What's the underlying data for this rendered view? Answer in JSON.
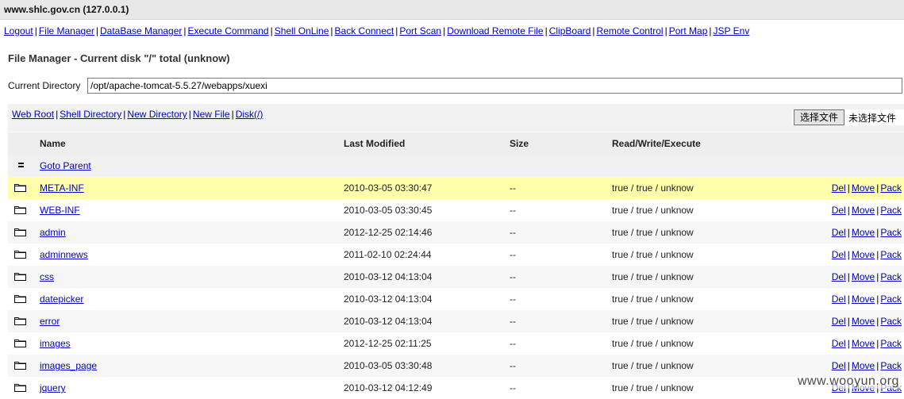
{
  "window": {
    "title": "www.shlc.gov.cn (127.0.0.1)"
  },
  "nav": {
    "items": [
      {
        "label": "Logout",
        "name": "nav-logout"
      },
      {
        "label": "File Manager",
        "name": "nav-file-manager"
      },
      {
        "label": "DataBase Manager",
        "name": "nav-database-manager"
      },
      {
        "label": "Execute Command",
        "name": "nav-execute-command"
      },
      {
        "label": "Shell OnLine",
        "name": "nav-shell-online"
      },
      {
        "label": "Back Connect",
        "name": "nav-back-connect"
      },
      {
        "label": "Port Scan",
        "name": "nav-port-scan"
      },
      {
        "label": "Download Remote File",
        "name": "nav-download-remote-file"
      },
      {
        "label": "ClipBoard",
        "name": "nav-clipboard"
      },
      {
        "label": "Remote Control",
        "name": "nav-remote-control"
      },
      {
        "label": "Port Map",
        "name": "nav-port-map"
      },
      {
        "label": "JSP Env",
        "name": "nav-jsp-env"
      }
    ],
    "separator": "|"
  },
  "page": {
    "title": "File Manager - Current disk \"/\" total (unknow)",
    "current_directory_label": "Current Directory",
    "current_directory_value": "/opt/apache-tomcat-5.5.27/webapps/xuexi"
  },
  "actions": {
    "items": [
      {
        "label": "Web Root",
        "name": "action-web-root"
      },
      {
        "label": "Shell Directory",
        "name": "action-shell-directory"
      },
      {
        "label": "New Directory",
        "name": "action-new-directory"
      },
      {
        "label": "New File",
        "name": "action-new-file"
      },
      {
        "label": "Disk(/)",
        "name": "action-disk"
      }
    ],
    "upload_button": "选择文件",
    "upload_status": "未选择文件"
  },
  "table": {
    "headers": {
      "name": "Name",
      "modified": "Last Modified",
      "size": "Size",
      "rwx": "Read/Write/Execute"
    },
    "parent_label": "Goto Parent",
    "ops": {
      "del": "Del",
      "move": "Move",
      "pack": "Pack"
    },
    "rows": [
      {
        "name": "META-INF",
        "modified": "2010-03-05 03:30:47",
        "size": "--",
        "rwx": "true / true / unknow",
        "highlight": true
      },
      {
        "name": "WEB-INF",
        "modified": "2010-03-05 03:30:45",
        "size": "--",
        "rwx": "true / true / unknow"
      },
      {
        "name": "admin",
        "modified": "2012-12-25 02:14:46",
        "size": "--",
        "rwx": "true / true / unknow"
      },
      {
        "name": "adminnews",
        "modified": "2011-02-10 02:24:44",
        "size": "--",
        "rwx": "true / true / unknow"
      },
      {
        "name": "css",
        "modified": "2010-03-12 04:13:04",
        "size": "--",
        "rwx": "true / true / unknow"
      },
      {
        "name": "datepicker",
        "modified": "2010-03-12 04:13:04",
        "size": "--",
        "rwx": "true / true / unknow"
      },
      {
        "name": "error",
        "modified": "2010-03-12 04:13:04",
        "size": "--",
        "rwx": "true / true / unknow"
      },
      {
        "name": "images",
        "modified": "2012-12-25 02:11:25",
        "size": "--",
        "rwx": "true / true / unknow"
      },
      {
        "name": "images_page",
        "modified": "2010-03-05 03:30:48",
        "size": "--",
        "rwx": "true / true / unknow"
      },
      {
        "name": "jquery",
        "modified": "2010-03-12 04:12:49",
        "size": "--",
        "rwx": "true / true / unknow"
      }
    ]
  },
  "watermark": "www.wooyun.org"
}
